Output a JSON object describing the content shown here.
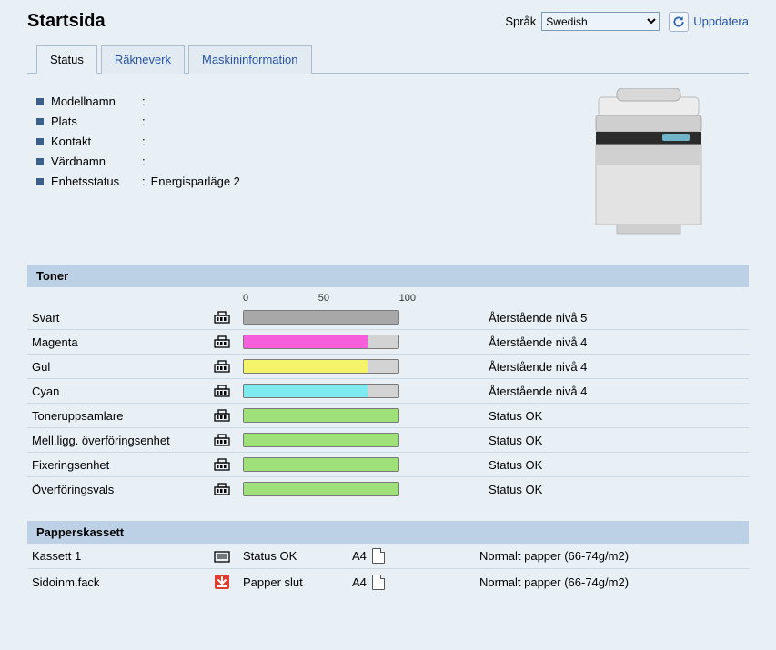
{
  "header": {
    "title": "Startsida",
    "lang_label": "Språk",
    "lang_selected": "Swedish",
    "refresh": "Uppdatera"
  },
  "tabs": [
    {
      "id": "status",
      "label": "Status",
      "active": true
    },
    {
      "id": "counter",
      "label": "Räkneverk",
      "active": false
    },
    {
      "id": "machine",
      "label": "Maskininformation",
      "active": false
    }
  ],
  "info": {
    "model": {
      "label": "Modellnamn",
      "value": ""
    },
    "location": {
      "label": "Plats",
      "value": ""
    },
    "contact": {
      "label": "Kontakt",
      "value": ""
    },
    "hostname": {
      "label": "Värdnamn",
      "value": ""
    },
    "unit_status": {
      "label": "Enhetsstatus",
      "value": "Energisparläge 2"
    }
  },
  "toner": {
    "heading": "Toner",
    "scale": [
      "0",
      "50",
      "100"
    ],
    "rows": [
      {
        "name": "Svart",
        "percent": 100,
        "color": "#a8a8a8",
        "status": "Återstående nivå 5"
      },
      {
        "name": "Magenta",
        "percent": 80,
        "color": "#f65edb",
        "status": "Återstående nivå 4"
      },
      {
        "name": "Gul",
        "percent": 80,
        "color": "#f5f36a",
        "status": "Återstående nivå 4"
      },
      {
        "name": "Cyan",
        "percent": 80,
        "color": "#7ee9ee",
        "status": "Återstående nivå 4"
      },
      {
        "name": "Toneruppsamlare",
        "percent": 100,
        "color": "#9fe07a",
        "status": "Status OK"
      },
      {
        "name": "Mell.ligg. överföringsenhet",
        "percent": 100,
        "color": "#9fe07a",
        "status": "Status OK"
      },
      {
        "name": "Fixeringsenhet",
        "percent": 100,
        "color": "#9fe07a",
        "status": "Status OK"
      },
      {
        "name": "Överföringsvals",
        "percent": 100,
        "color": "#9fe07a",
        "status": "Status OK"
      }
    ]
  },
  "trays": {
    "heading": "Papperskassett",
    "rows": [
      {
        "name": "Kassett 1",
        "state": "ok",
        "status": "Status OK",
        "size": "A4",
        "type": "Normalt papper (66-74g/m2)"
      },
      {
        "name": "Sidoinm.fack",
        "state": "empty",
        "status": "Papper slut",
        "size": "A4",
        "type": "Normalt papper (66-74g/m2)"
      }
    ]
  }
}
